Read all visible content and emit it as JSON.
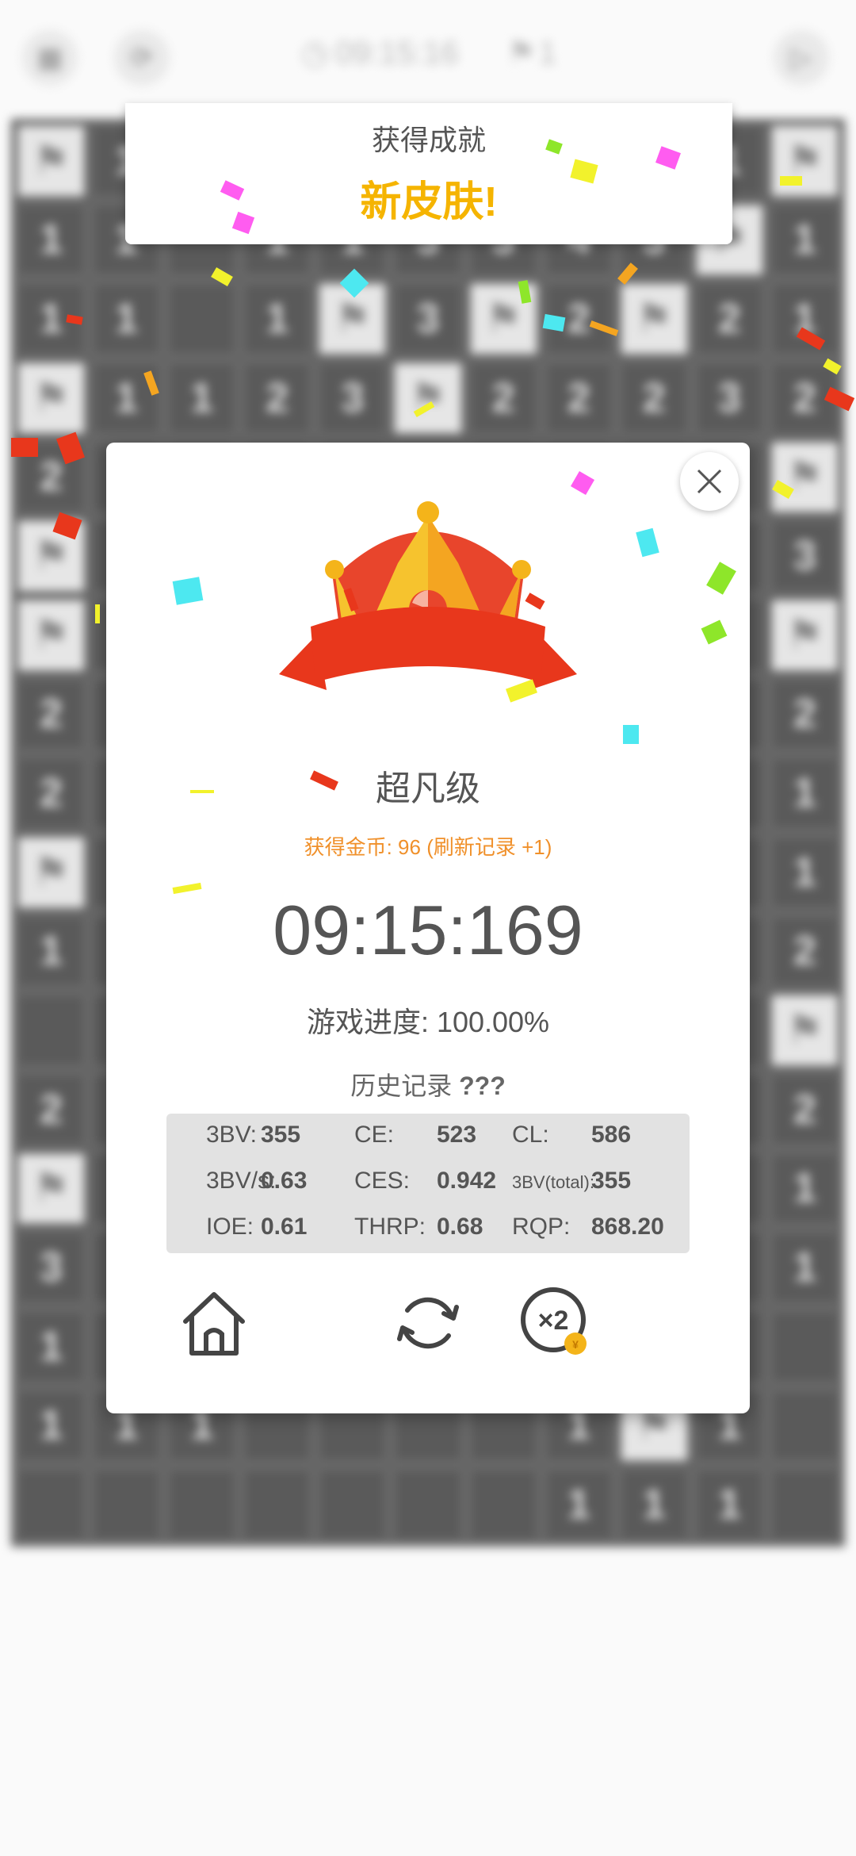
{
  "game": {
    "timer": "09:15:16",
    "flags": "1",
    "board_rows": [
      [
        "F",
        "1",
        "",
        "",
        "",
        "",
        "",
        "",
        "",
        "1",
        "F"
      ],
      [
        "1",
        "1",
        "",
        "1",
        "1",
        "3",
        "3",
        "4",
        "3",
        "F",
        "1"
      ],
      [
        "1",
        "1",
        "",
        "1",
        "F",
        "3",
        "F",
        "2",
        "F",
        "2",
        "1"
      ],
      [
        "F",
        "1",
        "1",
        "2",
        "3",
        "F",
        "2",
        "2",
        "2",
        "3",
        "2"
      ],
      [
        "2",
        "",
        "",
        "",
        "",
        "",
        "",
        "",
        "",
        "",
        "F"
      ],
      [
        "F",
        "",
        "",
        "",
        "",
        "",
        "",
        "",
        "",
        "",
        "3"
      ],
      [
        "F",
        "",
        "",
        "",
        "",
        "",
        "",
        "",
        "",
        "",
        "F"
      ],
      [
        "2",
        "",
        "",
        "",
        "",
        "",
        "",
        "",
        "",
        "",
        "2"
      ],
      [
        "2",
        "",
        "",
        "",
        "",
        "",
        "",
        "",
        "",
        "",
        "1"
      ],
      [
        "F",
        "",
        "",
        "",
        "",
        "",
        "",
        "",
        "",
        "",
        "1"
      ],
      [
        "1",
        "",
        "",
        "",
        "",
        "",
        "",
        "",
        "",
        "",
        "2"
      ],
      [
        "",
        "",
        "",
        "",
        "",
        "",
        "",
        "",
        "",
        "",
        "F"
      ],
      [
        "2",
        "",
        "",
        "",
        "",
        "",
        "",
        "",
        "",
        "",
        "2"
      ],
      [
        "F",
        "",
        "",
        "",
        "",
        "",
        "",
        "",
        "",
        "",
        "1"
      ],
      [
        "3",
        "",
        "",
        "",
        "",
        "",
        "",
        "",
        "",
        "",
        "1"
      ],
      [
        "1",
        "",
        "",
        "",
        "",
        "",
        "",
        "",
        "",
        "",
        ""
      ],
      [
        "1",
        "1",
        "1",
        "",
        "",
        "",
        "",
        "1",
        "F",
        "1",
        ""
      ],
      [
        "",
        "",
        "",
        "",
        "",
        "",
        "",
        "1",
        "1",
        "1",
        ""
      ]
    ]
  },
  "achievement": {
    "title": "获得成就",
    "subtitle": "新皮肤!"
  },
  "result": {
    "badge_text": "刷新记录",
    "rank": "超凡级",
    "coins": "获得金币: 96 (刷新记录 +1)",
    "time": "09:15:169",
    "progress": "游戏进度: 100.00%",
    "history_label": "历史记录",
    "history_value": "???",
    "stats": {
      "bv_label": "3BV:",
      "bv": "355",
      "ce_label": "CE:",
      "ce": "523",
      "cl_label": "CL:",
      "cl": "586",
      "bvs_label": "3BV/s:",
      "bvs": "0.63",
      "ces_label": "CES:",
      "ces": "0.942",
      "bvt_label": "3BV(total):",
      "bvt": "355",
      "ioe_label": "IOE:",
      "ioe": "0.61",
      "thrp_label": "THRP:",
      "thrp": "0.68",
      "rqp_label": "RQP:",
      "rqp": "868.20"
    }
  },
  "colors": {
    "accent_orange": "#f0902a",
    "gold": "#f5b400",
    "ribbon_red": "#e8371c"
  }
}
